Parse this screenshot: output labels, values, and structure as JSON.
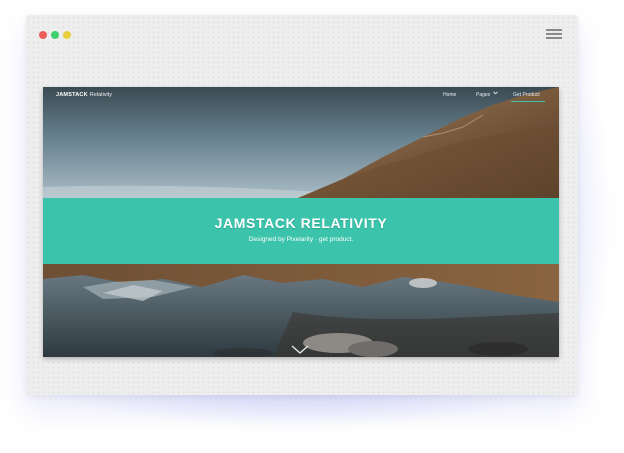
{
  "window": {
    "colors": {
      "close": "#ef5a5a",
      "minimize": "#3ecf6e",
      "zoom": "#e6cf3a"
    }
  },
  "site": {
    "brand": {
      "name": "JAMSTACK",
      "tagline": "Relativity"
    },
    "nav": {
      "home": "Home",
      "pages": "Pages",
      "get_product": "Get Product"
    },
    "accent_color": "#3cc3ab",
    "hero": {
      "title": "JAMSTACK RELATIVITY",
      "subtitle": "Designed by Pixelarity · get product."
    },
    "icons": {
      "menu": "hamburger-icon",
      "pages_dropdown": "chevron-down-icon",
      "scroll": "chevron-down-icon"
    }
  }
}
